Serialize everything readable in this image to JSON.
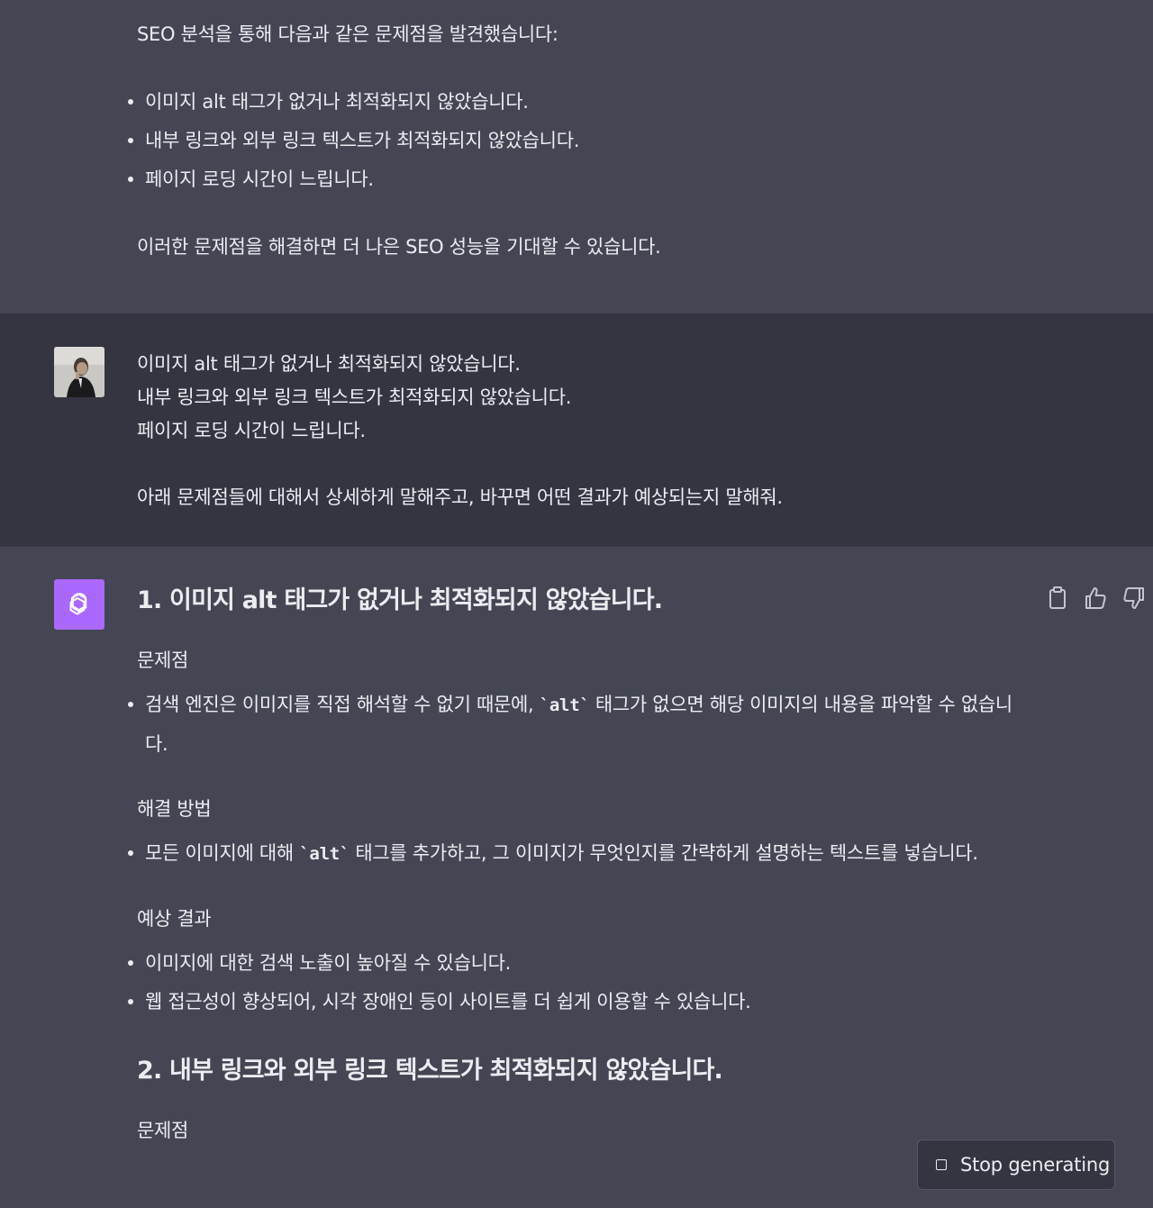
{
  "prev_assistant": {
    "intro": "SEO 분석을 통해 다음과 같은 문제점을 발견했습니다:",
    "bullets": [
      "이미지 alt 태그가 없거나 최적화되지 않았습니다.",
      "내부 링크와 외부 링크 텍스트가 최적화되지 않았습니다.",
      "페이지 로딩 시간이 느립니다."
    ],
    "conclusion": "이러한 문제점을 해결하면 더 나은 SEO 성능을 기대할 수 있습니다."
  },
  "user": {
    "lines": [
      "이미지 alt 태그가 없거나 최적화되지 않았습니다.",
      "내부 링크와 외부 링크 텍스트가 최적화되지 않았습니다.",
      "페이지 로딩 시간이 느립니다."
    ],
    "request": "아래 문제점들에 대해서 상세하게 말해주고, 바꾸면 어떤 결과가 예상되는지 말해줘."
  },
  "assistant": {
    "heading1": "1. 이미지 alt 태그가 없거나 최적화되지 않았습니다.",
    "problem_label": "문제점",
    "problem_pre": "검색 엔진은 이미지를 직접 해석할 수 없기 때문에, ",
    "problem_code": "`alt`",
    "problem_post": " 태그가 없으면 해당 이미지의 내용을 파악할 수 없습니다.",
    "solution_label": "해결 방법",
    "solution_pre": "모든 이미지에 대해 ",
    "solution_code": "`alt`",
    "solution_post": " 태그를 추가하고, 그 이미지가 무엇인지를 간략하게 설명하는 텍스트를 넣습니다.",
    "result_label": "예상 결과",
    "results": [
      "이미지에 대한 검색 노출이 높아질 수 있습니다.",
      "웹 접근성이 향상되어, 시각 장애인 등이 사이트를 더 쉽게 이용할 수 있습니다."
    ],
    "heading2": "2. 내부 링크와 외부 링크 텍스트가 최적화되지 않았습니다.",
    "problem_label2": "문제점"
  },
  "stop_button": {
    "label": "Stop generating"
  },
  "icons": {
    "copy": "clipboard-icon",
    "like": "thumbs-up-icon",
    "dislike": "thumbs-down-icon",
    "bot": "openai-logo-icon",
    "stop": "stop-square-icon"
  },
  "colors": {
    "assistant_bg": "#444654",
    "user_bg": "#343541",
    "bot_avatar": "#ab68ff",
    "text": "#ececf1"
  }
}
